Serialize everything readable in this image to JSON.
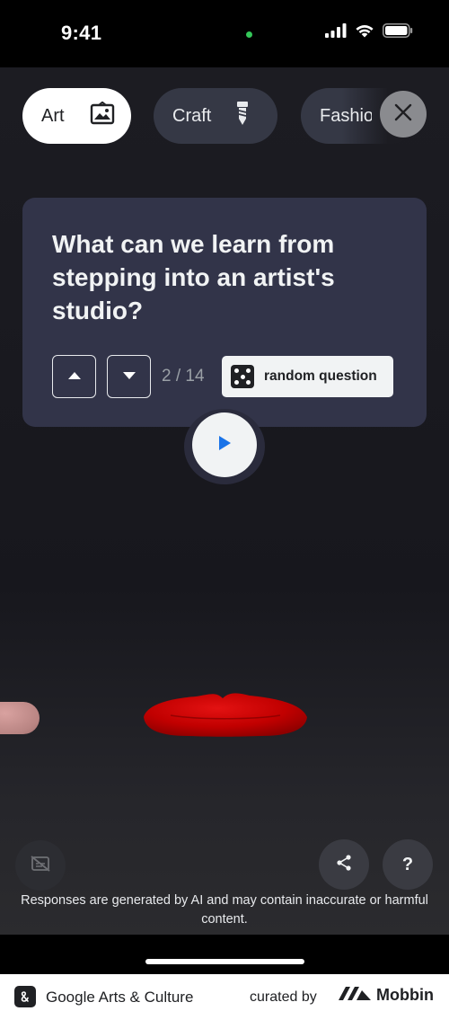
{
  "status_bar": {
    "time": "9:41"
  },
  "categories": [
    {
      "label": "Art",
      "icon": "image-frame-icon",
      "selected": true
    },
    {
      "label": "Craft",
      "icon": "screw-icon",
      "selected": false
    },
    {
      "label": "Fashion",
      "icon": "",
      "selected": false
    }
  ],
  "close": {
    "icon": "close-icon"
  },
  "question_card": {
    "question": "What can we learn from stepping into an artist's studio?",
    "counter": "2 / 14",
    "random_label": "random question"
  },
  "player": {
    "icon": "play-icon"
  },
  "actions": {
    "captions_icon": "captions-off-icon",
    "share_icon": "share-icon",
    "help_label": "?"
  },
  "disclaimer": "Responses are generated by AI and may contain inaccurate or harmful content.",
  "footer": {
    "app_name": "Google Arts & Culture",
    "curated_by": "curated by",
    "brand": "Mobbin"
  },
  "colors": {
    "background": "#1c1c22",
    "card": "#323449",
    "chip_inactive": "#353845",
    "play_accent": "#1a73e8",
    "lips": "#c40000"
  }
}
